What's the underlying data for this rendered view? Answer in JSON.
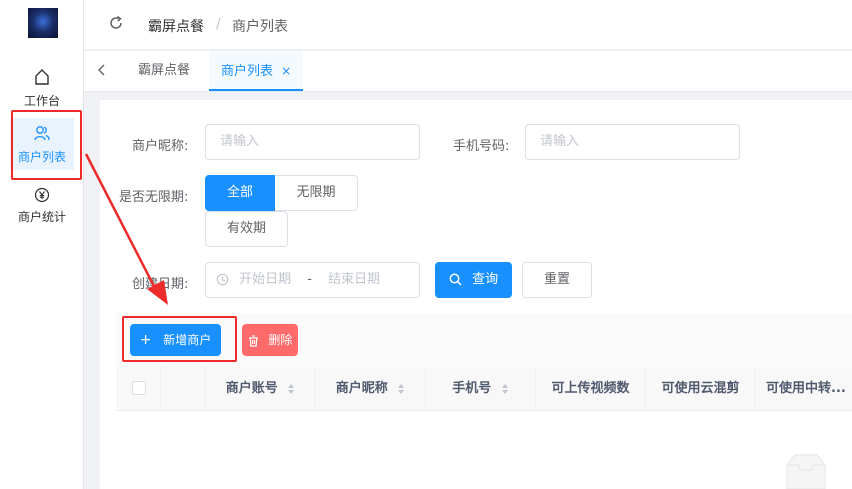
{
  "sidebar": {
    "items": [
      {
        "label": "工作台",
        "icon": "home-icon"
      },
      {
        "label": "商户列表",
        "icon": "users-icon",
        "active": true
      },
      {
        "label": "商户统计",
        "icon": "yen-icon"
      }
    ]
  },
  "header": {
    "breadcrumb": [
      "霸屏点餐",
      "/",
      "商户列表"
    ]
  },
  "tabs": [
    {
      "label": "霸屏点餐"
    },
    {
      "label": "商户列表",
      "active": true,
      "close": "×"
    }
  ],
  "filters": {
    "nickname_label": "商户昵称:",
    "nickname_placeholder": "请输入",
    "phone_label": "手机号码:",
    "phone_placeholder": "请输入",
    "unlimited_label": "是否无限期:",
    "unlimited_options": [
      "全部",
      "无限期",
      "有效期"
    ],
    "date_label": "创建日期:",
    "date_start": "开始日期",
    "date_sep": "-",
    "date_end": "结束日期",
    "search_btn": "查询",
    "reset_btn": "重置"
  },
  "toolbar": {
    "add_btn": "新增商户",
    "add_prefix": "+",
    "delete_btn": "删除"
  },
  "table": {
    "columns": [
      "商户账号",
      "商户昵称",
      "手机号",
      "可上传视频数",
      "可使用云混剪",
      "可使用中转..."
    ]
  },
  "colors": {
    "primary": "#1890ff",
    "danger": "#ff6b6b",
    "annotation": "#ee2b2b"
  }
}
